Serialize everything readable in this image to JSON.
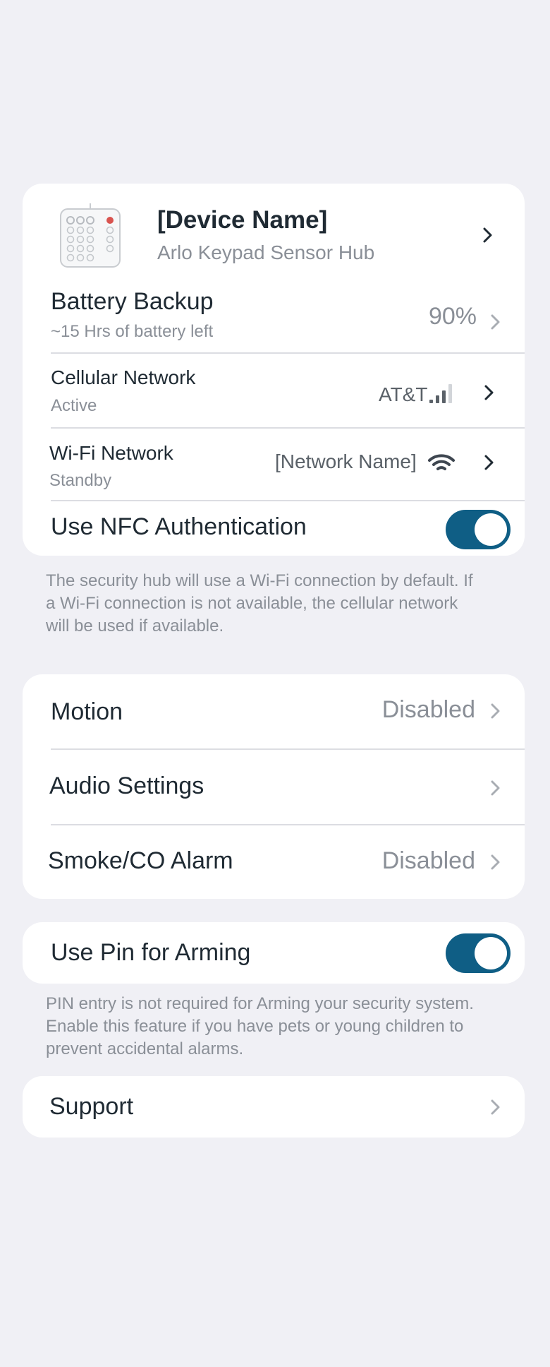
{
  "device": {
    "name": "[Device Name]",
    "model": "Arlo Keypad Sensor Hub",
    "image_icon": "keypad-device-icon"
  },
  "battery": {
    "label": "Battery Backup",
    "subtitle": "~15 Hrs of battery left",
    "value": "90%"
  },
  "cellular": {
    "label": "Cellular Network",
    "status": "Active",
    "carrier": "AT&T",
    "signal_bars": 3,
    "signal_max": 4,
    "icon": "cellular-signal-icon"
  },
  "wifi": {
    "label": "Wi-Fi Network",
    "status": "Standby",
    "network_name": "[Network Name]",
    "icon": "wifi-icon"
  },
  "nfc": {
    "label": "Use NFC Authentication",
    "enabled": true
  },
  "hub_note": "The security hub will use a Wi-Fi connection by default. If\na Wi-Fi connection is not available, the cellular network\nwill be used if available.",
  "motion": {
    "label": "Motion",
    "value": "Disabled"
  },
  "audio": {
    "label": "Audio Settings"
  },
  "smoke": {
    "label": "Smoke/CO Alarm",
    "value": "Disabled"
  },
  "pin": {
    "label": "Use Pin for Arming",
    "enabled": true
  },
  "pin_note": "PIN entry is not required for Arming your security system.\nEnable this feature if you have pets or young children to\nprevent accidental alarms.",
  "support": {
    "label": "Support"
  },
  "colors": {
    "background": "#f0f0f5",
    "card": "#ffffff",
    "toggle_on": "#0f5e85",
    "secondary_text": "#8a8f97"
  }
}
